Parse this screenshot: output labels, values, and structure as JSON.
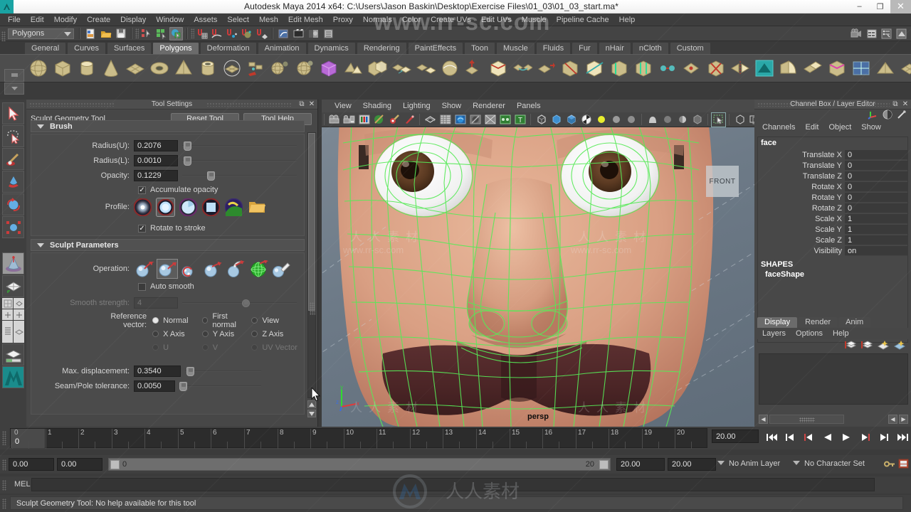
{
  "window": {
    "title": "Autodesk Maya 2014 x64: C:\\Users\\Jason Baskin\\Desktop\\Exercise Files\\01_03\\01_03_start.ma*",
    "minimize": "–",
    "restore": "❐",
    "close": "✕"
  },
  "menubar": {
    "items": [
      "File",
      "Edit",
      "Modify",
      "Create",
      "Display",
      "Window",
      "Assets",
      "Select",
      "Mesh",
      "Edit Mesh",
      "Proxy",
      "Normals",
      "Color",
      "Create UVs",
      "Edit UVs",
      "Muscle",
      "Pipeline Cache",
      "Help"
    ]
  },
  "statusline": {
    "mode": "Polygons",
    "icons": [
      "new-scene-icon",
      "open-scene-icon",
      "save-scene-icon",
      "select-by-hierarchy-icon",
      "select-by-object-icon",
      "select-by-component-icon",
      "snap-to-grid-icon",
      "snap-to-curve-icon",
      "snap-to-point-icon",
      "snap-to-projected-center-icon",
      "snap-to-view-plane-icon",
      "construction-history-icon",
      "render-current-frame-icon",
      "ipr-render-icon",
      "render-settings-icon",
      "hypershade-icon",
      "rendering-flags-icon",
      "playblast-icon",
      "show-editor-icon",
      "attribute-editor-icon",
      "tool-settings-icon",
      "channel-box-icon"
    ]
  },
  "shelf": {
    "tabs": [
      "General",
      "Curves",
      "Surfaces",
      "Polygons",
      "Deformation",
      "Animation",
      "Dynamics",
      "Rendering",
      "PaintEffects",
      "Toon",
      "Muscle",
      "Fluids",
      "Fur",
      "nHair",
      "nCloth",
      "Custom"
    ],
    "selected_tab": "Polygons",
    "icons": [
      "poly-sphere-icon",
      "poly-cube-icon",
      "poly-cylinder-icon",
      "poly-cone-icon",
      "poly-plane-icon",
      "poly-torus-icon",
      "poly-pyramid-icon",
      "poly-pipe-icon",
      "poly-prism-icon",
      "poly-soccer-ball-icon",
      "poly-helix-icon",
      "poly-gear-icon",
      "poly-sphere-2-icon",
      "poly-platonic-icon",
      "poly-boolean-icon",
      "poly-combine-icon",
      "poly-separate-icon",
      "poly-smooth-icon",
      "poly-extrude-icon",
      "poly-bevel-icon",
      "poly-bridge-icon",
      "poly-append-icon",
      "poly-split-icon",
      "poly-cut-icon",
      "poly-insert-edge-loop-icon",
      "poly-offset-edge-loop-icon",
      "poly-merge-icon",
      "poly-collapse-icon",
      "poly-delete-edge-icon",
      "poly-mirror-icon",
      "sculpt-geometry-tool-icon",
      "poly-wedge-icon",
      "poly-duplicate-face-icon",
      "poly-crease-icon",
      "poly-uv-icon",
      "poly-triangulate-icon",
      "poly-quadrangulate-icon",
      "poly-reduce-icon",
      "poly-transfer-icon",
      "poly-sculpt-icon"
    ]
  },
  "toolbox": {
    "items": [
      {
        "name": "select-tool",
        "icon": "arrow-cursor-icon",
        "selected": false
      },
      {
        "name": "lasso-tool",
        "icon": "lasso-icon",
        "selected": false
      },
      {
        "name": "paint-selection-tool",
        "icon": "paint-brush-icon",
        "selected": false
      },
      {
        "name": "move-tool",
        "icon": "move-arrow-icon",
        "selected": false
      },
      {
        "name": "rotate-tool",
        "icon": "rotate-ring-icon",
        "selected": false
      },
      {
        "name": "scale-tool",
        "icon": "scale-box-icon",
        "selected": false
      },
      {
        "name": "last-tool-used",
        "icon": "sculpt-cone-icon",
        "selected": true
      },
      {
        "name": "single-view-layout",
        "icon": "single-pane-icon",
        "selected": false
      },
      {
        "name": "four-view-layout",
        "icon": "four-pane-icon",
        "selected": false
      },
      {
        "name": "outliner-persp-layout",
        "icon": "outliner-pane-icon",
        "selected": false
      },
      {
        "name": "persp-graph-layout",
        "icon": "persp-graph-icon",
        "selected": false
      },
      {
        "name": "maya-embedded-language",
        "icon": "maya-logo-icon",
        "selected": false
      }
    ]
  },
  "tool_settings": {
    "panel_title": "Tool Settings",
    "tool_name": "Sculpt Geometry Tool",
    "reset_label": "Reset Tool",
    "help_label": "Tool Help",
    "brush": {
      "section_label": "Brush",
      "fields": [
        {
          "label": "Radius(U):",
          "value": "0.2076",
          "knob_pct": 2
        },
        {
          "label": "Radius(L):",
          "value": "0.0010",
          "knob_pct": 2
        },
        {
          "label": "Opacity:",
          "value": "0.1229",
          "knob_pct": 12
        }
      ],
      "accumulate_label": "Accumulate opacity",
      "accumulate_checked": true,
      "profile_label": "Profile:",
      "profiles": [
        "gaussian-brush-icon",
        "soft-brush-icon",
        "solid-brush-icon",
        "square-brush-icon",
        "image-brush-icon",
        "browse-folder-icon"
      ],
      "profile_selected_index": 1,
      "rotate_label": "Rotate to stroke",
      "rotate_checked": true
    },
    "sculpt": {
      "section_label": "Sculpt Parameters",
      "operation_label": "Operation:",
      "operations": [
        "push-operation-icon",
        "pull-operation-icon",
        "smooth-operation-icon",
        "relax-operation-icon",
        "pinch-operation-icon",
        "slide-operation-icon",
        "erase-operation-icon"
      ],
      "operation_selected_index": 1,
      "auto_smooth_label": "Auto smooth",
      "auto_smooth_checked": false,
      "smooth_strength_label": "Smooth strength:",
      "smooth_strength_value": "4",
      "smooth_strength_knob_pct": 33,
      "reference_vector_label": "Reference vector:",
      "reference_options": [
        [
          {
            "label": "Normal",
            "on": true,
            "dim": false
          },
          {
            "label": "First normal",
            "on": false,
            "dim": false
          },
          {
            "label": "View",
            "on": false,
            "dim": false
          }
        ],
        [
          {
            "label": "X Axis",
            "on": false,
            "dim": false
          },
          {
            "label": "Y Axis",
            "on": false,
            "dim": false
          },
          {
            "label": "Z Axis",
            "on": false,
            "dim": false
          }
        ],
        [
          {
            "label": "U",
            "on": false,
            "dim": true
          },
          {
            "label": "V",
            "on": false,
            "dim": true
          },
          {
            "label": "UV Vector",
            "on": false,
            "dim": true
          }
        ]
      ],
      "max_displacement_label": "Max. displacement:",
      "max_displacement_value": "0.3540",
      "max_displacement_knob_pct": 2,
      "seam_pole_label": "Seam/Pole tolerance:",
      "seam_pole_value": "0.0050",
      "seam_pole_knob_pct": 0
    }
  },
  "viewport": {
    "menus": [
      "View",
      "Shading",
      "Lighting",
      "Show",
      "Renderer",
      "Panels"
    ],
    "camera_label": "persp",
    "front_plate_label": "FRONT",
    "axis_labels": {
      "y": "y",
      "x": "x",
      "z": "z"
    },
    "toolbar_icons": [
      "select-camera-icon",
      "camera-attributes-icon",
      "show-bookmarks-icon",
      "paint-effects-globe-icon",
      "ipr-tear-icon",
      "grab-render-icon",
      "wireframe-icon",
      "grid-toggle-icon",
      "texture-toggle-icon",
      "shadows-toggle-icon",
      "xray-toggle-icon",
      "xray-joints-icon",
      "text-toggle-icon",
      "wireframe-shade-icon",
      "smooth-shade-icon",
      "flat-shade-icon",
      "bounding-box-icon",
      "light-toggle-icon",
      "default-light-icon",
      "all-lights-icon",
      "shadow-icon",
      "occlusion-icon",
      "motion-blur-icon",
      "multisample-icon",
      "isolate-select-icon",
      "xray-display-icon",
      "single-pane-icon",
      "two-pane-icon",
      "hypergraph-icon"
    ],
    "model_mesh_color": "#5cf05c",
    "skin_color": "#d89f85",
    "background_color": "#6d7a87"
  },
  "channelbox": {
    "panel_title": "Channel Box / Layer Editor",
    "menus": [
      "Channels",
      "Edit",
      "Object",
      "Show"
    ],
    "object_name": "face",
    "channels": [
      {
        "name": "Translate X",
        "value": "0"
      },
      {
        "name": "Translate Y",
        "value": "0"
      },
      {
        "name": "Translate Z",
        "value": "0"
      },
      {
        "name": "Rotate X",
        "value": "0"
      },
      {
        "name": "Rotate Y",
        "value": "0"
      },
      {
        "name": "Rotate Z",
        "value": "0"
      },
      {
        "name": "Scale X",
        "value": "1"
      },
      {
        "name": "Scale Y",
        "value": "1"
      },
      {
        "name": "Scale Z",
        "value": "1"
      },
      {
        "name": "Visibility",
        "value": "on"
      }
    ],
    "shapes_label": "SHAPES",
    "shape_name": "faceShape"
  },
  "layereditor": {
    "tabs": [
      "Display",
      "Render",
      "Anim"
    ],
    "selected_tab": "Display",
    "menus": [
      "Layers",
      "Options",
      "Help"
    ],
    "icons": [
      "new-layer-icon",
      "new-layer-from-selected-icon",
      "move-layer-up-icon",
      "move-layer-down-icon"
    ]
  },
  "timeline": {
    "current_frame": "0",
    "ticks": [
      "0",
      "1",
      "2",
      "3",
      "4",
      "5",
      "6",
      "7",
      "8",
      "9",
      "10",
      "11",
      "12",
      "13",
      "14",
      "15",
      "16",
      "17",
      "18",
      "19",
      "20"
    ],
    "time_field": "20.00",
    "playback_buttons": [
      "go-to-start-icon",
      "step-back-key-icon",
      "step-back-frame-icon",
      "play-backwards-icon",
      "play-forwards-icon",
      "step-forward-frame-icon",
      "step-forward-key-icon",
      "go-to-end-icon"
    ]
  },
  "rangebar": {
    "start_field": "0.00",
    "end_field": "0.00",
    "slider_left_label": "0",
    "slider_right_label": "20",
    "playback_start": "20.00",
    "playback_end": "20.00",
    "anim_layer": "No Anim Layer",
    "character_set": "No Character Set",
    "key_icon": "auto-keyframe-icon",
    "prefs_icon": "animation-preferences-icon"
  },
  "melbar": {
    "label": "MEL",
    "command_value": ""
  },
  "helpline": {
    "message": "Sculpt Geometry Tool: No help available for this tool"
  },
  "watermarks": {
    "top": "www.rr-sc.com",
    "mid": "人人素材",
    "url": "www.rr-sc.com",
    "bottom": "人人素材"
  }
}
